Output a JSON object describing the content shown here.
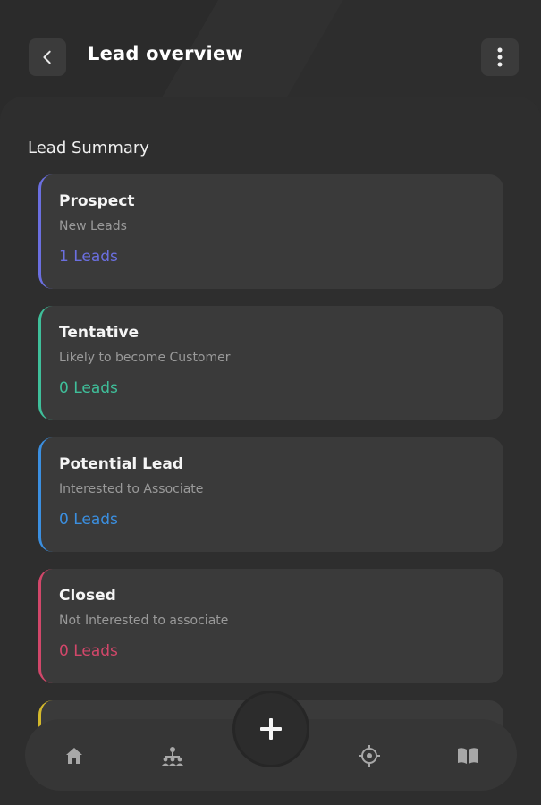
{
  "header": {
    "title": "Lead overview",
    "back_icon": "chevron-left-icon",
    "menu_icon": "more-vertical-icon"
  },
  "summary": {
    "title": "Lead Summary",
    "cards": [
      {
        "title": "Prospect",
        "subtitle": "New Leads",
        "count": "1 Leads",
        "color": "#6b6fe0"
      },
      {
        "title": "Tentative",
        "subtitle": "Likely to become Customer",
        "count": "0 Leads",
        "color": "#3fbf9a"
      },
      {
        "title": "Potential Lead",
        "subtitle": "Interested to Associate",
        "count": "0 Leads",
        "color": "#3b8fe0"
      },
      {
        "title": "Closed",
        "subtitle": "Not Interested to associate",
        "count": "0 Leads",
        "color": "#d2476a"
      }
    ],
    "partial_card_color": "#d4b92c"
  },
  "bottom_nav": {
    "items": [
      {
        "icon": "home-icon"
      },
      {
        "icon": "team-icon"
      },
      {
        "icon": "add-icon"
      },
      {
        "icon": "target-icon"
      },
      {
        "icon": "book-icon"
      }
    ]
  }
}
